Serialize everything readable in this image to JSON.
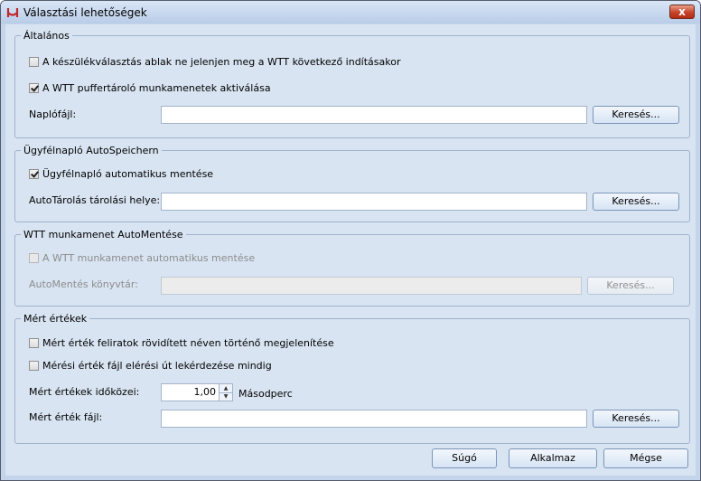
{
  "window": {
    "title": "Választási lehetőségek",
    "close_glyph": "x"
  },
  "general": {
    "legend": "Általános",
    "cb_hide_device": {
      "label": "A készülékválasztás ablak ne jelenjen meg a WTT következő indításakor",
      "checked": false
    },
    "cb_buffer": {
      "label": "A WTT puffertároló munkamenetek aktiválása",
      "checked": true
    },
    "logfile_label": "Naplófájl:",
    "logfile_value": "",
    "browse_label": "Keresés..."
  },
  "client_log": {
    "legend": "Ügyfélnapló AutoSpeichern",
    "cb_autosave": {
      "label": "Ügyfélnapló automatikus mentése",
      "checked": true
    },
    "path_label": "AutoTárolás tárolási helye:",
    "path_value": "",
    "browse_label": "Keresés..."
  },
  "session": {
    "legend": "WTT munkamenet AutoMentése",
    "cb_autosave": {
      "label": "A WTT munkamenet automatikus mentése",
      "checked": false
    },
    "dir_label": "AutoMentés könyvtár:",
    "dir_value": "",
    "browse_label": "Keresés..."
  },
  "measured": {
    "legend": "Mért értékek",
    "cb_short_names": {
      "label": "Mért érték feliratok rövidített néven történő megjelenítése",
      "checked": false
    },
    "cb_ask_path": {
      "label": "Mérési érték fájl elérési út lekérdezése mindig",
      "checked": false
    },
    "interval_label": "Mért értékek időközei:",
    "interval_value": "1,00",
    "interval_unit": "Másodperc",
    "file_label": "Mért érték fájl:",
    "file_value": "",
    "browse_label": "Keresés..."
  },
  "footer": {
    "help": "Súgó",
    "apply": "Alkalmaz",
    "cancel": "Mégse"
  },
  "colors": {
    "accent": "#c5432a",
    "frame": "#c4d4ea",
    "client": "#d8e4f2"
  }
}
